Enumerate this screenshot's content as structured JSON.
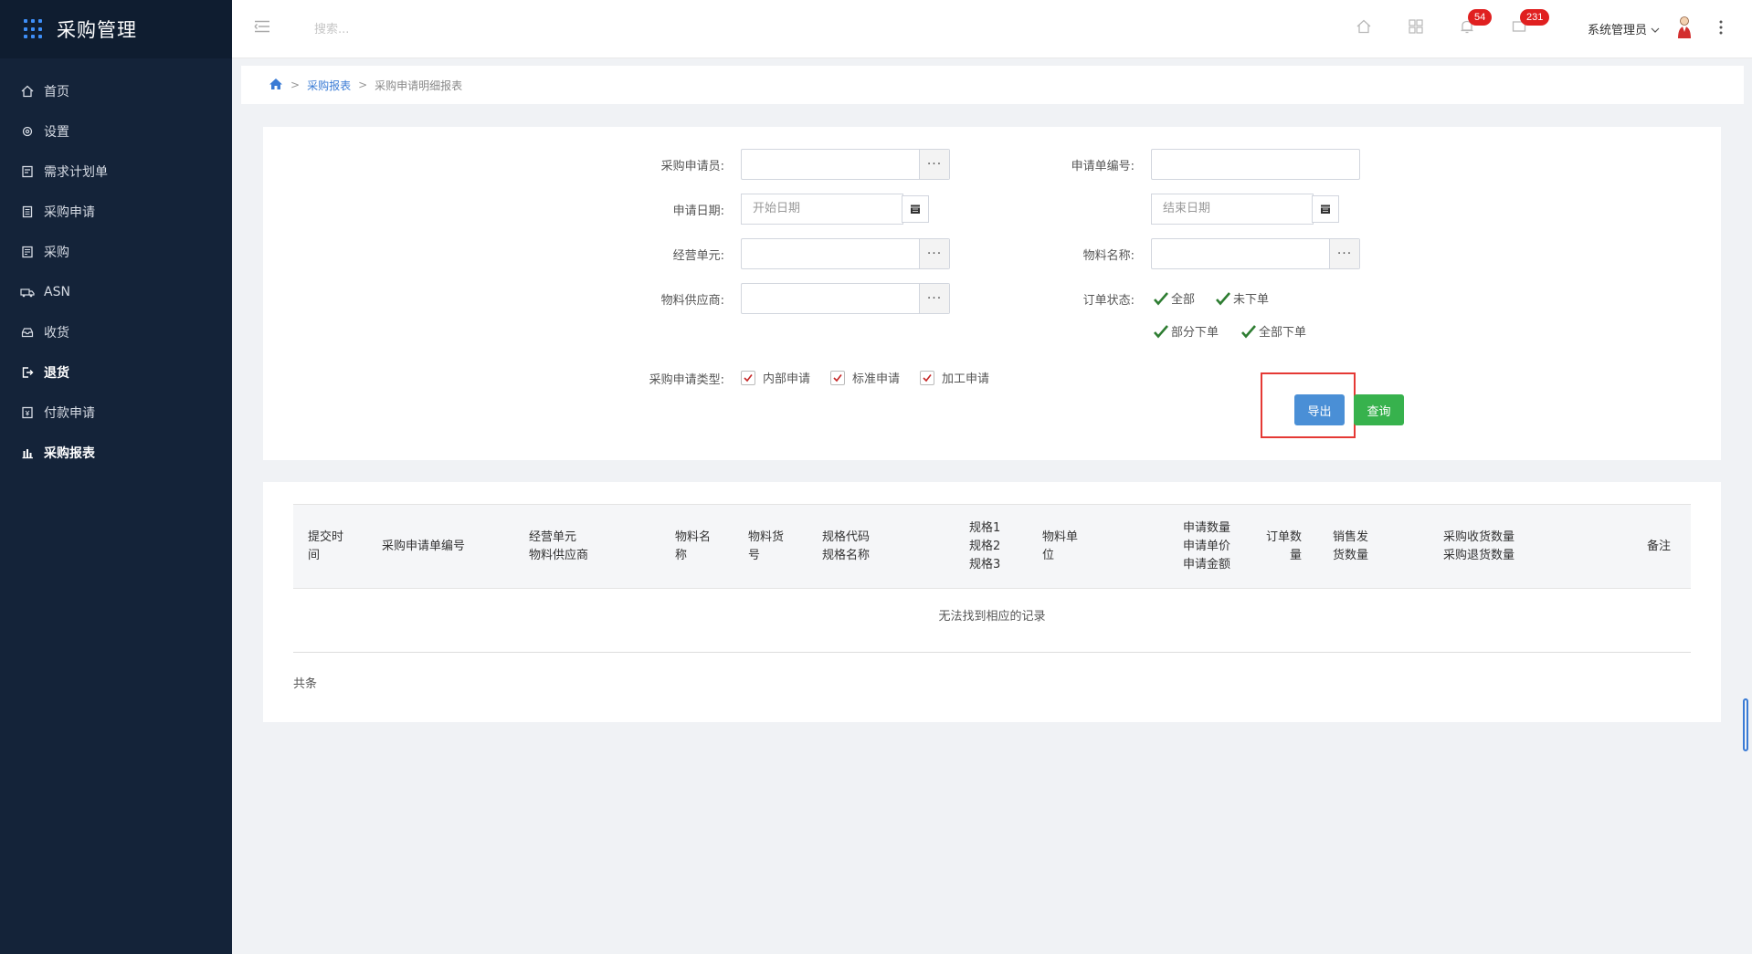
{
  "app": {
    "title": "采购管理"
  },
  "sidebar": {
    "items": [
      {
        "label": "首页",
        "icon": "home-icon"
      },
      {
        "label": "设置",
        "icon": "gear-icon"
      },
      {
        "label": "需求计划单",
        "icon": "document-icon"
      },
      {
        "label": "采购申请",
        "icon": "clipboard-icon"
      },
      {
        "label": "采购",
        "icon": "list-icon"
      },
      {
        "label": "ASN",
        "icon": "truck-icon"
      },
      {
        "label": "收货",
        "icon": "inbox-icon"
      },
      {
        "label": "退货",
        "icon": "exit-icon"
      },
      {
        "label": "付款申请",
        "icon": "payment-icon"
      },
      {
        "label": "采购报表",
        "icon": "bar-chart-icon"
      }
    ]
  },
  "topbar": {
    "search_placeholder": "搜索...",
    "bell_badge": "54",
    "message_badge": "231",
    "user_name": "系统管理员"
  },
  "breadcrumb": {
    "parent": "采购报表",
    "current": "采购申请明细报表"
  },
  "form": {
    "applicant_label": "采购申请员:",
    "request_no_label": "申请单编号:",
    "date_label": "申请日期:",
    "start_placeholder": "开始日期",
    "end_placeholder": "结束日期",
    "business_unit_label": "经营单元:",
    "material_name_label": "物料名称:",
    "supplier_label": "物料供应商:",
    "order_status_label": "订单状态:",
    "status_all": "全部",
    "status_not_ordered": "未下单",
    "status_partial": "部分下单",
    "status_all_ordered": "全部下单",
    "type_label": "采购申请类型:",
    "type_internal": "内部申请",
    "type_standard": "标准申请",
    "type_processing": "加工申请",
    "export_label": "导出",
    "query_label": "查询"
  },
  "table": {
    "headers": {
      "submit_time_1": "提交时",
      "submit_time_2": "间",
      "request_no": "采购申请单编号",
      "unit_1": "经营单元",
      "unit_2": "物料供应商",
      "mat_name_1": "物料名",
      "mat_name_2": "称",
      "mat_code_1": "物料货",
      "mat_code_2": "号",
      "spec_code_1": "规格代码",
      "spec_code_2": "规格名称",
      "spec_1": "规格1",
      "spec_2": "规格2",
      "spec_3": "规格3",
      "uom_1": "物料单",
      "uom_2": "位",
      "qty_1": "申请数量",
      "qty_2": "申请单价",
      "qty_3": "申请金额",
      "order_qty_1": "订单数",
      "order_qty_2": "量",
      "sales_1": "销售发",
      "sales_2": "货数量",
      "recv_1": "采购收货数量",
      "recv_2": "采购退货数量",
      "remark": "备注"
    },
    "empty_text": "无法找到相应的记录",
    "total_text": "共条"
  }
}
